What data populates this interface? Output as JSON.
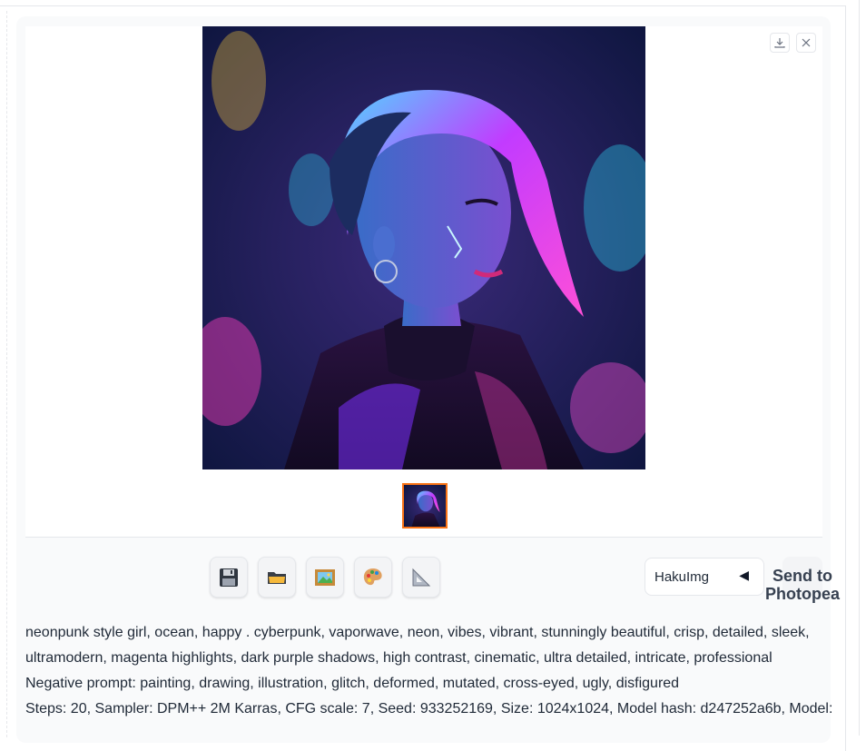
{
  "gallery": {
    "download_label": "Download",
    "close_label": "Close"
  },
  "toolbar": {
    "buttons": [
      {
        "name": "save",
        "icon": "floppy-disk-icon"
      },
      {
        "name": "zip",
        "icon": "file-folder-icon"
      },
      {
        "name": "send-to-img2img",
        "icon": "framed-picture-icon"
      },
      {
        "name": "send-to-inpaint",
        "icon": "artist-palette-icon"
      },
      {
        "name": "send-to-extras",
        "icon": "triangular-ruler-icon"
      }
    ],
    "dropdown_value": "HakuImg",
    "dropdown_arrow": "◀",
    "send_to_photopea_label": "Send to Photopea"
  },
  "generation_info": {
    "prompt": "neonpunk style girl, ocean, happy . cyberpunk, vaporwave, neon, vibes, vibrant, stunningly beautiful, crisp, detailed, sleek, ultramodern, magenta highlights, dark purple shadows, high contrast, cinematic, ultra detailed, intricate, professional",
    "negative_prompt": "Negative prompt: painting, drawing, illustration, glitch, deformed, mutated, cross-eyed, ugly, disfigured",
    "params": "Steps: 20, Sampler: DPM++ 2M Karras, CFG scale: 7, Seed: 933252169, Size: 1024x1024, Model hash: d247252a6b, Model:"
  }
}
